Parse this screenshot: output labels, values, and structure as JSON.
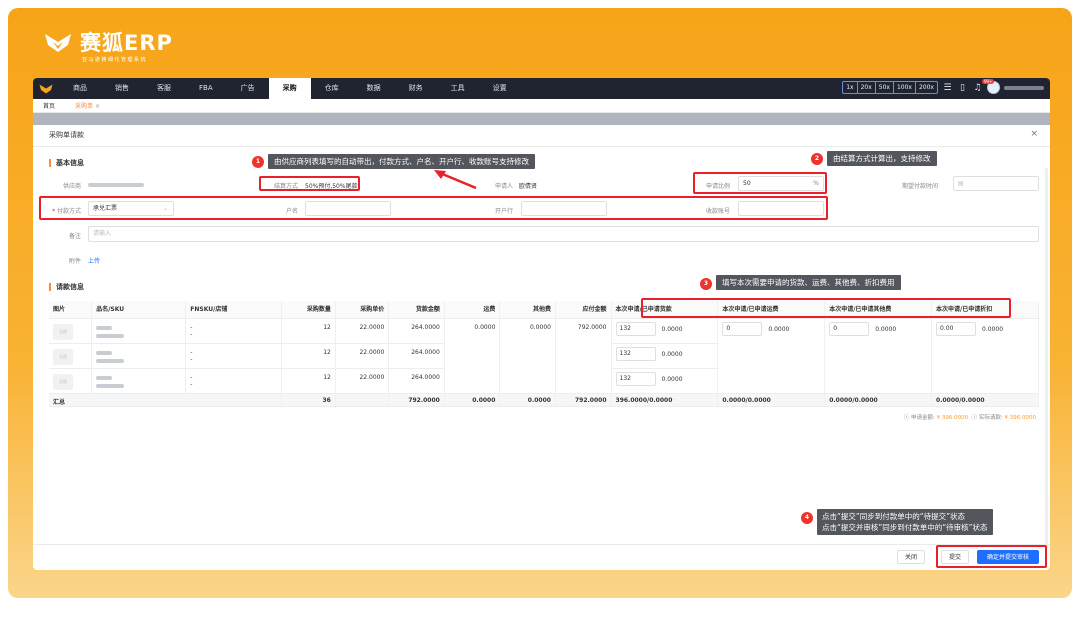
{
  "brand": {
    "name": "赛狐ERP",
    "tagline": "亚马逊精细化管理系统"
  },
  "nav": {
    "items": [
      "商品",
      "销售",
      "客服",
      "FBA",
      "广告",
      "采购",
      "仓库",
      "数据",
      "财务",
      "工具",
      "设置"
    ],
    "active": "采购",
    "speeds": [
      "1x",
      "20x",
      "50x",
      "100x",
      "200x"
    ],
    "badge": "99+"
  },
  "tabs": {
    "home": "首页",
    "current": "采购单",
    "close": "×"
  },
  "modal": {
    "title": "采购单请款",
    "close": "×"
  },
  "basic": {
    "section": "基本信息",
    "supplier_label": "供应商",
    "settle_label": "结算方式",
    "settle_value": "50%预付,50%尾款",
    "applicant_label": "申请人",
    "applicant_value": "欧倩贤",
    "ratio_label": "申请比例",
    "ratio_value": "50",
    "ratio_unit": "%",
    "pay_date_label": "期望付款时间",
    "pay_method_label": "付款方式",
    "pay_method_value": "承兑汇票",
    "account_name_label": "户名",
    "bank_label": "开户行",
    "account_no_label": "收款账号",
    "remark_label": "备注",
    "remark_placeholder": "请输入",
    "attach_label": "附件",
    "upload": "上传"
  },
  "req": {
    "section": "请款信息",
    "headers": [
      "图片",
      "品名/SKU",
      "FNSKU/店铺",
      "采购数量",
      "采购单价",
      "货款金额",
      "运费",
      "其他费",
      "应付金额",
      "本次申请/已申请货款",
      "本次申请/已申请运费",
      "本次申请/已申请其他费",
      "本次申请/已申请折扣"
    ],
    "rows": [
      {
        "fnsku": "-",
        "fnsku2": "-",
        "qty": "12",
        "price": "22.0000",
        "amount": "264.0000",
        "freight": "0.0000",
        "other": "0.0000",
        "payable": "792.0000",
        "goods_in": "132",
        "goods_done": "0.0000",
        "freight_in": "0",
        "freight_done": "0.0000",
        "other_in": "0",
        "other_done": "0.0000",
        "disc_in": "0.00",
        "disc_done": "0.0000"
      },
      {
        "fnsku": "-",
        "fnsku2": "-",
        "qty": "12",
        "price": "22.0000",
        "amount": "264.0000",
        "goods_in": "132",
        "goods_done": "0.0000"
      },
      {
        "fnsku": "-",
        "fnsku2": "-",
        "qty": "12",
        "price": "22.0000",
        "amount": "264.0000",
        "goods_in": "132",
        "goods_done": "0.0000"
      }
    ],
    "thumb": "无图",
    "sum": {
      "label": "汇总",
      "qty": "36",
      "amount": "792.0000",
      "freight": "0.0000",
      "other": "0.0000",
      "payable": "792.0000",
      "goods": "396.0000/0.0000",
      "freight_s": "0.0000/0.0000",
      "other_s": "0.0000/0.0000",
      "disc_s": "0.0000/0.0000"
    },
    "apply_label": "申请金额:",
    "apply_value": "¥ 396.0000",
    "actual_label": "实际请款:",
    "actual_value": "¥ 396.0000"
  },
  "tips": {
    "t1": "由供应商列表填写的自动带出，付款方式、户名、开户行、收款账号支持修改",
    "t2": "由结算方式计算出，支持修改",
    "t3": "填写本次需要申请的货款、运费、其他费、折扣费用",
    "t4a": "点击“提交”同步到付款单中的“待提交”状态",
    "t4b": "点击“提交并审核”同步到付款单中的“待审核”状态",
    "n1": "1",
    "n2": "2",
    "n3": "3",
    "n4": "4"
  },
  "footer": {
    "close": "关闭",
    "submit": "提交",
    "submit_audit": "确定并提交审核"
  }
}
